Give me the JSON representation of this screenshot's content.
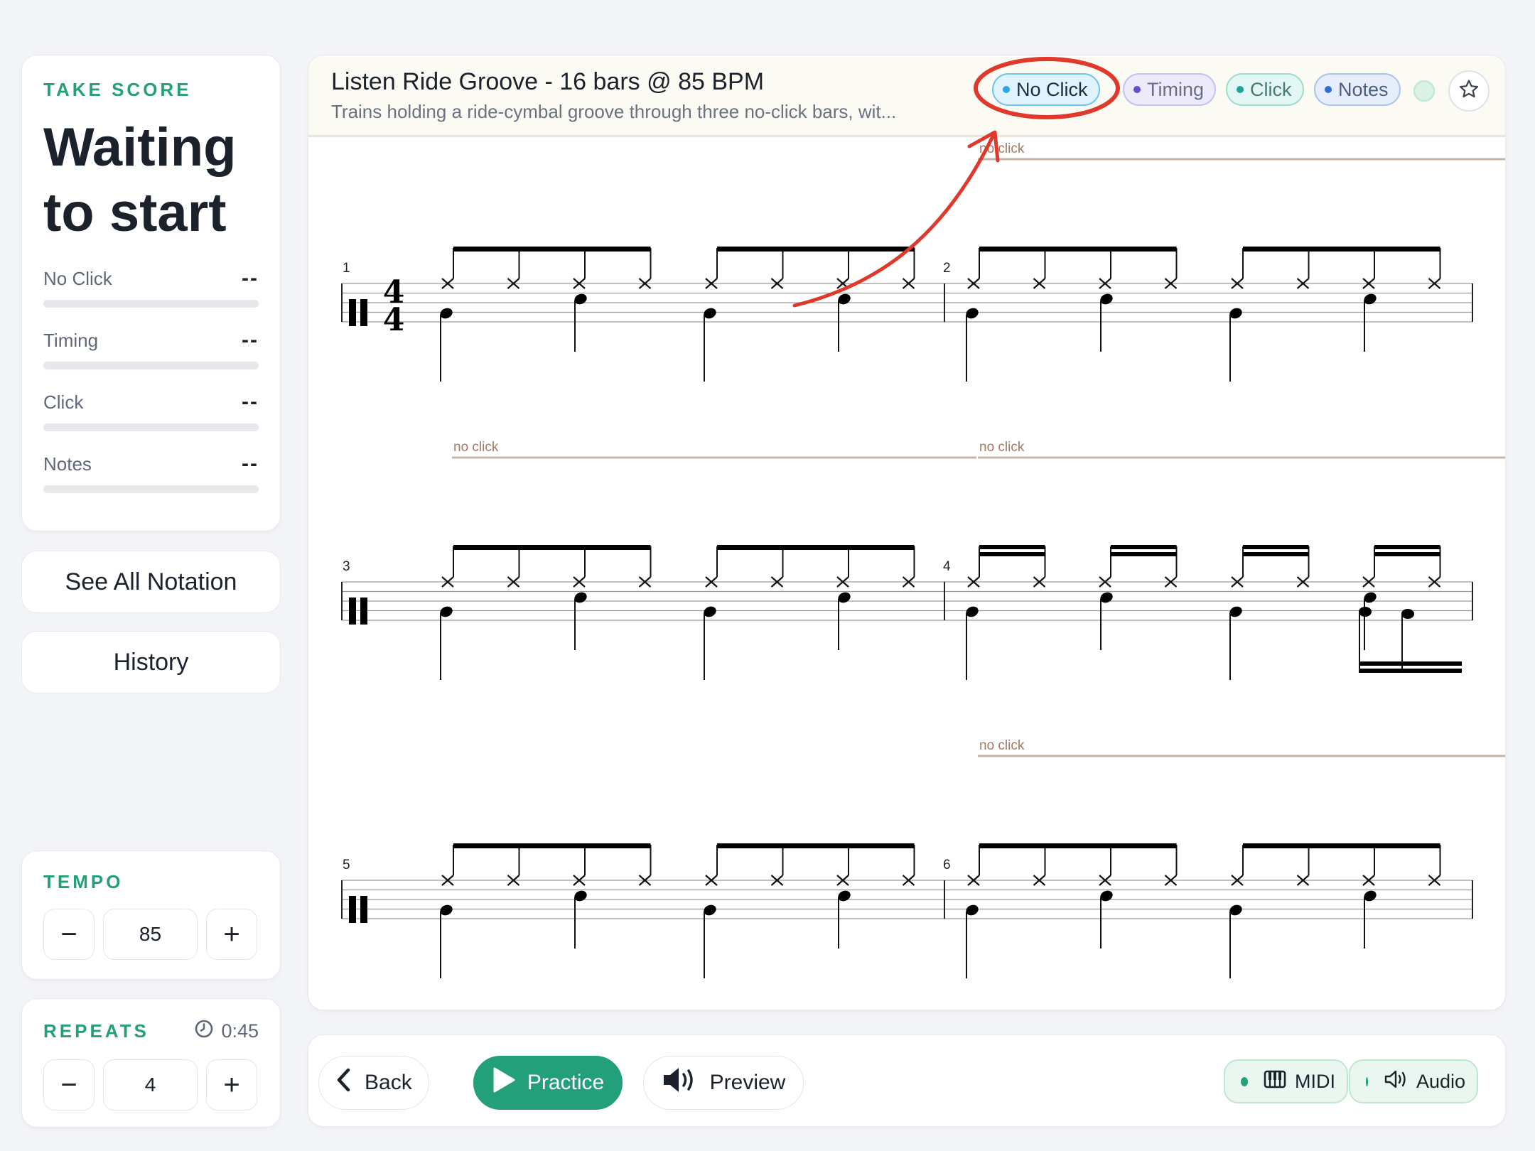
{
  "score": {
    "eyebrow": "TAKE SCORE",
    "status": "Waiting to start",
    "metrics": [
      {
        "label": "No Click",
        "value": "--"
      },
      {
        "label": "Timing",
        "value": "--"
      },
      {
        "label": "Click",
        "value": "--"
      },
      {
        "label": "Notes",
        "value": "--"
      }
    ]
  },
  "nav": {
    "see_all": "See All Notation",
    "history": "History"
  },
  "tempo": {
    "label": "TEMPO",
    "value": "85",
    "minus": "−",
    "plus": "+"
  },
  "repeats": {
    "label": "REPEATS",
    "duration": "0:45",
    "value": "4",
    "minus": "−",
    "plus": "+"
  },
  "exercise": {
    "title": "Listen Ride Groove - 16 bars @ 85 BPM",
    "subtitle": "Trains holding a ride-cymbal groove through three no-click bars, wit..."
  },
  "chips": [
    {
      "label": "No Click",
      "color": "#2fa4e2",
      "active": true
    },
    {
      "label": "Timing",
      "color": "#5a4ed1"
    },
    {
      "label": "Click",
      "color": "#1aa698"
    },
    {
      "label": "Notes",
      "color": "#2f6fd8"
    }
  ],
  "notation": {
    "time_signature": {
      "top": "4",
      "bottom": "4"
    },
    "no_click_label": "no click",
    "systems": [
      {
        "measures": [
          1,
          2
        ],
        "no_click_bars": [
          2
        ]
      },
      {
        "measures": [
          3,
          4
        ],
        "no_click_bars": [
          3,
          4
        ]
      },
      {
        "measures": [
          5,
          6
        ],
        "no_click_bars": [
          6
        ]
      }
    ]
  },
  "toolbar": {
    "back": "Back",
    "practice": "Practice",
    "preview": "Preview",
    "midi": "MIDI",
    "audio": "Audio"
  },
  "colors": {
    "accent": "#23a07a",
    "annotation": "#e0392b",
    "no_click_line": "#c9b3a7"
  }
}
